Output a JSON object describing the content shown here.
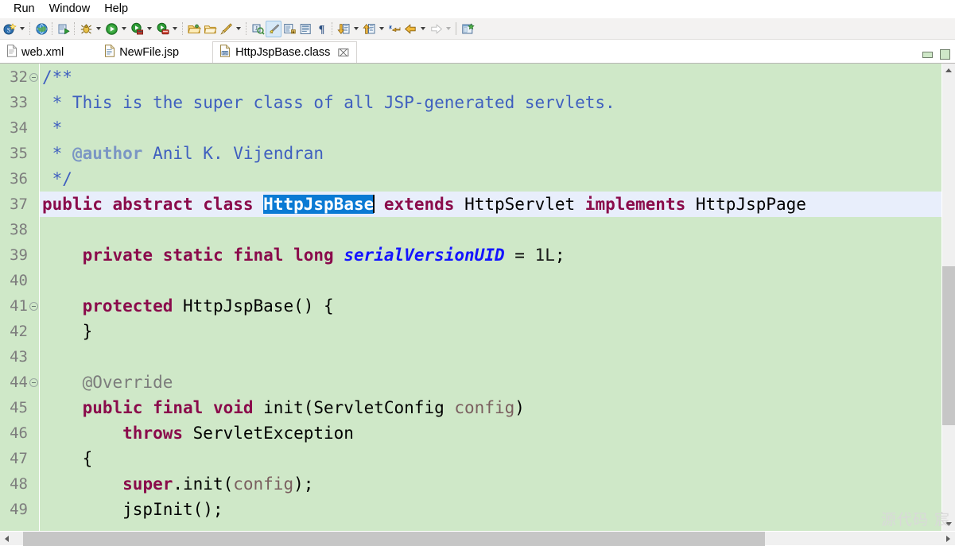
{
  "menubar": {
    "items": [
      {
        "label": "Run"
      },
      {
        "label": "Window"
      },
      {
        "label": "Help"
      }
    ]
  },
  "toolbar": {
    "groups": [
      {
        "name": "new-group",
        "buttons": [
          {
            "name": "new-wizard-icon",
            "tooltip": "New",
            "dropdown": true
          }
        ]
      },
      {
        "name": "browser-group",
        "buttons": [
          {
            "name": "open-web-browser-icon",
            "tooltip": "Open Web Browser",
            "dropdown": false
          }
        ]
      },
      {
        "name": "run-group",
        "buttons": [
          {
            "name": "run-last-tool-icon",
            "tooltip": "Run Last Tool",
            "dropdown": false
          },
          {
            "name": "debug-bug-icon",
            "tooltip": "Debug",
            "dropdown": true
          },
          {
            "name": "run-play-icon",
            "tooltip": "Run",
            "dropdown": true
          },
          {
            "name": "run-server-icon",
            "tooltip": "Run on Server",
            "dropdown": true
          },
          {
            "name": "stop-server-icon",
            "tooltip": "Stop Server",
            "dropdown": true
          }
        ]
      },
      {
        "name": "resource-group",
        "buttons": [
          {
            "name": "open-folder-icon",
            "tooltip": "Open Resource",
            "dropdown": false
          },
          {
            "name": "new-folder-icon",
            "tooltip": "New Folder",
            "dropdown": false
          },
          {
            "name": "marker-pen-icon",
            "tooltip": "Add Bookmark",
            "dropdown": true
          }
        ]
      },
      {
        "name": "java-group",
        "buttons": [
          {
            "name": "search-class-icon",
            "tooltip": "Search",
            "dropdown": false
          },
          {
            "name": "highlight-pen-icon",
            "tooltip": "Toggle Mark Occurrences",
            "selected": true,
            "dropdown": false
          },
          {
            "name": "block-selection-icon",
            "tooltip": "Toggle Block Selection",
            "dropdown": false
          },
          {
            "name": "show-whitespace-icon",
            "tooltip": "Show Whitespace Characters",
            "dropdown": false
          },
          {
            "name": "pilcrow-icon",
            "tooltip": "Show Print Margin",
            "dropdown": false
          }
        ]
      },
      {
        "name": "navigate-group",
        "buttons": [
          {
            "name": "next-annotation-icon",
            "tooltip": "Next Annotation",
            "dropdown": true
          },
          {
            "name": "previous-annotation-icon",
            "tooltip": "Previous Annotation",
            "dropdown": true
          },
          {
            "name": "last-edit-location-icon",
            "tooltip": "Last Edit Location",
            "dropdown": false
          },
          {
            "name": "back-arrow-icon",
            "tooltip": "Back",
            "dropdown": true
          },
          {
            "name": "forward-arrow-icon",
            "tooltip": "Forward",
            "dropdown": true,
            "disabled": true
          }
        ]
      },
      {
        "name": "perspective-group",
        "buttons": [
          {
            "name": "open-perspective-icon",
            "tooltip": "Open Perspective",
            "dropdown": false
          }
        ]
      }
    ]
  },
  "tabs": [
    {
      "label": "web.xml",
      "icon": "xml-file-icon",
      "active": false,
      "closable": false
    },
    {
      "label": "NewFile.jsp",
      "icon": "jsp-file-icon",
      "active": false,
      "closable": false
    },
    {
      "label": "HttpJspBase.class",
      "icon": "class-file-icon",
      "active": true,
      "closable": true,
      "close_glyph": "⌧"
    }
  ],
  "window_controls": {
    "minimize": "minimize-button",
    "maximize": "maximize-button"
  },
  "editor": {
    "language": "Java",
    "background_color": "#cfe8c8",
    "current_line_color": "#e8eefb",
    "selection_color": "#0a7ad4",
    "first_visible_line": 32,
    "selected_text": "HttpJspBase",
    "lines": [
      {
        "number": "32",
        "fold": true,
        "tokens": [
          {
            "t": "/**",
            "c": "cmt"
          }
        ]
      },
      {
        "number": "33",
        "fold": false,
        "tokens": [
          {
            "t": " * This is the super class of all JSP-generated servlets.",
            "c": "cmt"
          }
        ]
      },
      {
        "number": "34",
        "fold": false,
        "tokens": [
          {
            "t": " *",
            "c": "cmt"
          }
        ]
      },
      {
        "number": "35",
        "fold": false,
        "tokens": [
          {
            "t": " * ",
            "c": "cmt"
          },
          {
            "t": "@author",
            "c": "tag"
          },
          {
            "t": " Anil K. Vijendran",
            "c": "cmt"
          }
        ]
      },
      {
        "number": "36",
        "fold": false,
        "tokens": [
          {
            "t": " */",
            "c": "cmt"
          }
        ]
      },
      {
        "number": "37",
        "fold": false,
        "highlight": true,
        "tokens": [
          {
            "t": "public abstract class",
            "c": "kw"
          },
          {
            "t": " ",
            "c": "txt"
          },
          {
            "t": "HttpJspBase",
            "c": "sel"
          },
          {
            "t": "caret",
            "c": "caret"
          },
          {
            "t": " ",
            "c": "txt"
          },
          {
            "t": "extends",
            "c": "kw"
          },
          {
            "t": " HttpServlet ",
            "c": "txt"
          },
          {
            "t": "implements",
            "c": "kw"
          },
          {
            "t": " HttpJspPage",
            "c": "txt"
          }
        ]
      },
      {
        "number": "38",
        "fold": false,
        "tokens": []
      },
      {
        "number": "39",
        "fold": false,
        "tokens": [
          {
            "t": "    ",
            "c": "txt"
          },
          {
            "t": "private static final long",
            "c": "kw"
          },
          {
            "t": " ",
            "c": "txt"
          },
          {
            "t": "serialVersionUID",
            "c": "fld"
          },
          {
            "t": " = ",
            "c": "txt"
          },
          {
            "t": "1L",
            "c": "num"
          },
          {
            "t": ";",
            "c": "txt"
          }
        ]
      },
      {
        "number": "40",
        "fold": false,
        "tokens": []
      },
      {
        "number": "41",
        "fold": true,
        "tokens": [
          {
            "t": "    ",
            "c": "txt"
          },
          {
            "t": "protected",
            "c": "kw"
          },
          {
            "t": " HttpJspBase() {",
            "c": "txt"
          }
        ]
      },
      {
        "number": "42",
        "fold": false,
        "tokens": [
          {
            "t": "    }",
            "c": "txt"
          }
        ]
      },
      {
        "number": "43",
        "fold": false,
        "tokens": []
      },
      {
        "number": "44",
        "fold": true,
        "tokens": [
          {
            "t": "    ",
            "c": "txt"
          },
          {
            "t": "@Override",
            "c": "ann"
          }
        ]
      },
      {
        "number": "45",
        "fold": false,
        "tokens": [
          {
            "t": "    ",
            "c": "txt"
          },
          {
            "t": "public final void",
            "c": "kw"
          },
          {
            "t": " init(ServletConfig ",
            "c": "txt"
          },
          {
            "t": "config",
            "c": "par"
          },
          {
            "t": ")",
            "c": "txt"
          }
        ]
      },
      {
        "number": "46",
        "fold": false,
        "tokens": [
          {
            "t": "        ",
            "c": "txt"
          },
          {
            "t": "throws",
            "c": "kw"
          },
          {
            "t": " ServletException",
            "c": "txt"
          }
        ]
      },
      {
        "number": "47",
        "fold": false,
        "tokens": [
          {
            "t": "    {",
            "c": "txt"
          }
        ]
      },
      {
        "number": "48",
        "fold": false,
        "tokens": [
          {
            "t": "        ",
            "c": "txt"
          },
          {
            "t": "super",
            "c": "kw"
          },
          {
            "t": ".init(",
            "c": "txt"
          },
          {
            "t": "config",
            "c": "par"
          },
          {
            "t": ");",
            "c": "txt"
          }
        ]
      },
      {
        "number": "49",
        "fold": false,
        "tokens": [
          {
            "t": "        jspInit();",
            "c": "txt"
          }
        ]
      }
    ]
  },
  "scrollbars": {
    "vertical": {
      "up_glyph": "▲",
      "down_glyph": "▼",
      "thumb_top_pct": 43,
      "thumb_height_pct": 36
    },
    "horizontal": {
      "left_glyph": "◀",
      "right_glyph": "▶",
      "thumb_left_pct": 1,
      "thumb_width_pct": 80
    }
  },
  "watermark": {
    "text": "源代码  宸"
  }
}
